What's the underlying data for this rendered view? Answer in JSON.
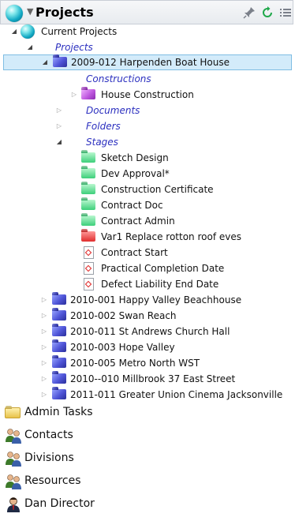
{
  "header": {
    "title": "Projects",
    "icons": [
      "pin-icon",
      "refresh-icon",
      "list-icon"
    ]
  },
  "tree": {
    "current_projects": "Current Projects",
    "projects_link": "Projects",
    "selected_project": "2009-012 Harpenden Boat House",
    "constructions": "Constructions",
    "house_construction": "House Construction",
    "documents": "Documents",
    "folders": "Folders",
    "stages": "Stages",
    "stage_items": [
      {
        "label": "Sketch Design",
        "color": "green"
      },
      {
        "label": "Dev Approval*",
        "color": "green"
      },
      {
        "label": "Construction Certificate",
        "color": "green"
      },
      {
        "label": "Contract Doc",
        "color": "green"
      },
      {
        "label": "Contract Admin",
        "color": "green"
      },
      {
        "label": "Var1 Replace rotton roof eves",
        "color": "red"
      }
    ],
    "date_items": [
      {
        "label": "Contract Start"
      },
      {
        "label": "Practical Completion Date"
      },
      {
        "label": "Defect Liability End Date"
      }
    ],
    "other_projects": [
      "2010-001 Happy Valley Beachhouse",
      "2010-002 Swan Reach",
      "2010-011 St Andrews Church Hall",
      "2010-003 Hope Valley",
      "2010-005 Metro North WST",
      "2010--010 Millbrook 37 East Street",
      "2011-011 Greater Union Cinema Jacksonville"
    ]
  },
  "bottom_items": [
    {
      "label": "Admin Tasks",
      "icon": "folder-icon"
    },
    {
      "label": "Contacts",
      "icon": "people-icon"
    },
    {
      "label": "Divisions",
      "icon": "people-icon"
    },
    {
      "label": "Resources",
      "icon": "people-icon"
    },
    {
      "label": "Dan Director",
      "icon": "person-icon"
    }
  ],
  "colors": {
    "selection_bg": "#d3ebfa",
    "selection_border": "#7fbde3",
    "link_text": "#2b2fbf"
  }
}
